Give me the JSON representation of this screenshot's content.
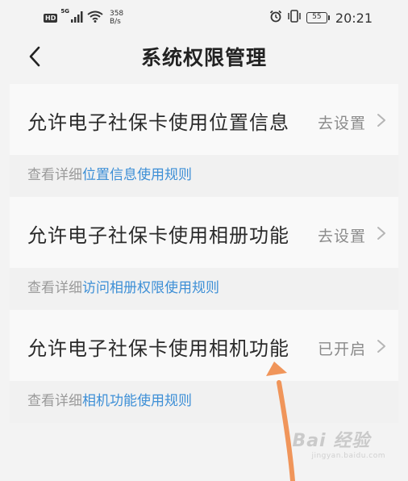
{
  "status_bar": {
    "hd_badge": "HD",
    "signal_type": "5G",
    "net_speed_value": "358",
    "net_speed_unit": "B/s",
    "battery_level": "55",
    "time": "20:21"
  },
  "nav": {
    "title": "系统权限管理"
  },
  "permissions": [
    {
      "label": "允许电子社保卡使用位置信息",
      "status": "去设置",
      "detail_prefix": "查看详细",
      "detail_link": "位置信息使用规则"
    },
    {
      "label": "允许电子社保卡使用相册功能",
      "status": "去设置",
      "detail_prefix": "查看详细",
      "detail_link": "访问相册权限使用规则"
    },
    {
      "label": "允许电子社保卡使用相机功能",
      "status": "已开启",
      "detail_prefix": "查看详细",
      "detail_link": "相机功能使用规则"
    }
  ],
  "watermark": {
    "main": "Bai 经验",
    "sub": "jingyan.baidu.com"
  },
  "colors": {
    "background": "#f3f3f3",
    "card": "#f9f9f9",
    "link": "#3d8fd6",
    "status_text": "#8a8a8a",
    "annotation_arrow": "#f0955a"
  },
  "icons": {
    "back": "chevron-left-icon",
    "row_action": "chevron-right-icon",
    "signal": "cellular-signal-icon",
    "wifi": "wifi-icon",
    "alarm": "alarm-clock-icon",
    "vibrate": "vibrate-icon",
    "battery": "battery-icon",
    "annotation": "annotation-arrow-icon"
  }
}
